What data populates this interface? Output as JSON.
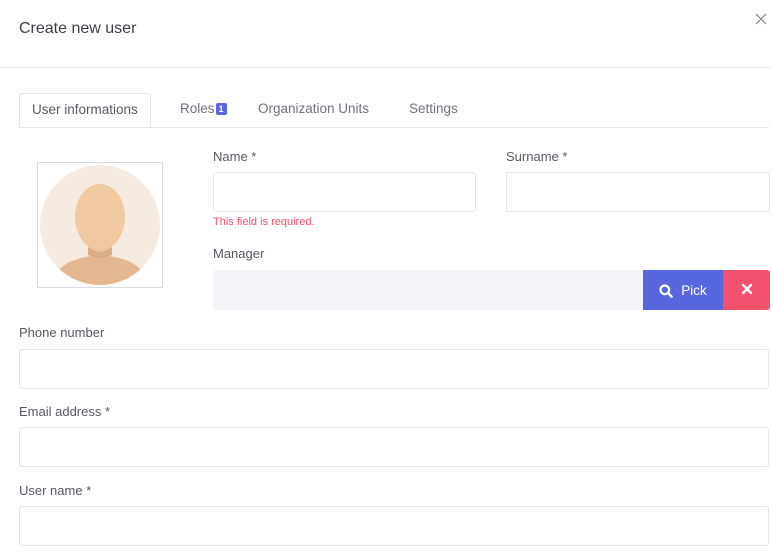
{
  "modal": {
    "title": "Create new user"
  },
  "tabs": [
    {
      "label": "User informations",
      "active": true
    },
    {
      "label": "Roles",
      "badge": "1"
    },
    {
      "label": "Organization Units"
    },
    {
      "label": "Settings"
    }
  ],
  "form": {
    "name": {
      "label": "Name *",
      "value": "",
      "error": "This field is required."
    },
    "surname": {
      "label": "Surname *",
      "value": ""
    },
    "manager": {
      "label": "Manager",
      "value": "",
      "pick_label": "Pick"
    },
    "phone": {
      "label": "Phone number",
      "value": ""
    },
    "email": {
      "label": "Email address *",
      "value": ""
    },
    "username": {
      "label": "User name *",
      "value": ""
    }
  },
  "icons": {
    "close": "close-icon",
    "search": "search-icon",
    "clear": "times-icon",
    "avatar": "default-avatar-icon"
  },
  "colors": {
    "primary": "#5867dd",
    "danger": "#f4516c",
    "border": "#e2e5ec",
    "text": "#575962"
  }
}
